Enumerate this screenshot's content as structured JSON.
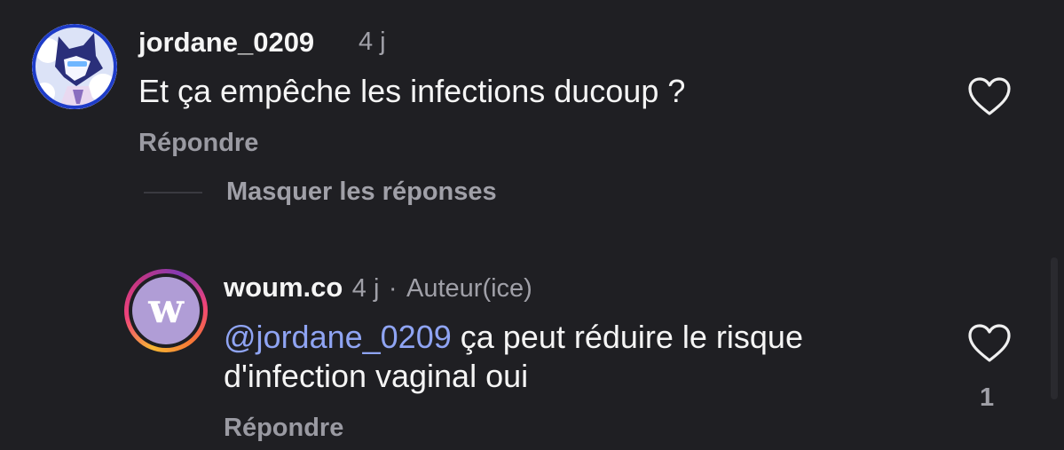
{
  "comment": {
    "username": "jordane_0209",
    "age": "4 j",
    "text": "Et ça empêche les infections ducoup ?",
    "reply_label": "Répondre"
  },
  "replies_toggle": "Masquer les réponses",
  "reply": {
    "username": "woum.co",
    "age": "4 j",
    "separator": "·",
    "role": "Auteur(ice)",
    "avatar_letter": "w",
    "mention": "@jordane_0209",
    "text_line1": " ça peut réduire le risque",
    "text_line2": "d'infection vaginal oui",
    "like_count": "1",
    "reply_label": "Répondre"
  },
  "icons": {
    "like": "heart-outline-icon"
  },
  "colors": {
    "background": "#1f1f23",
    "mention": "#8fa4f3",
    "muted": "#a0a0a8"
  }
}
